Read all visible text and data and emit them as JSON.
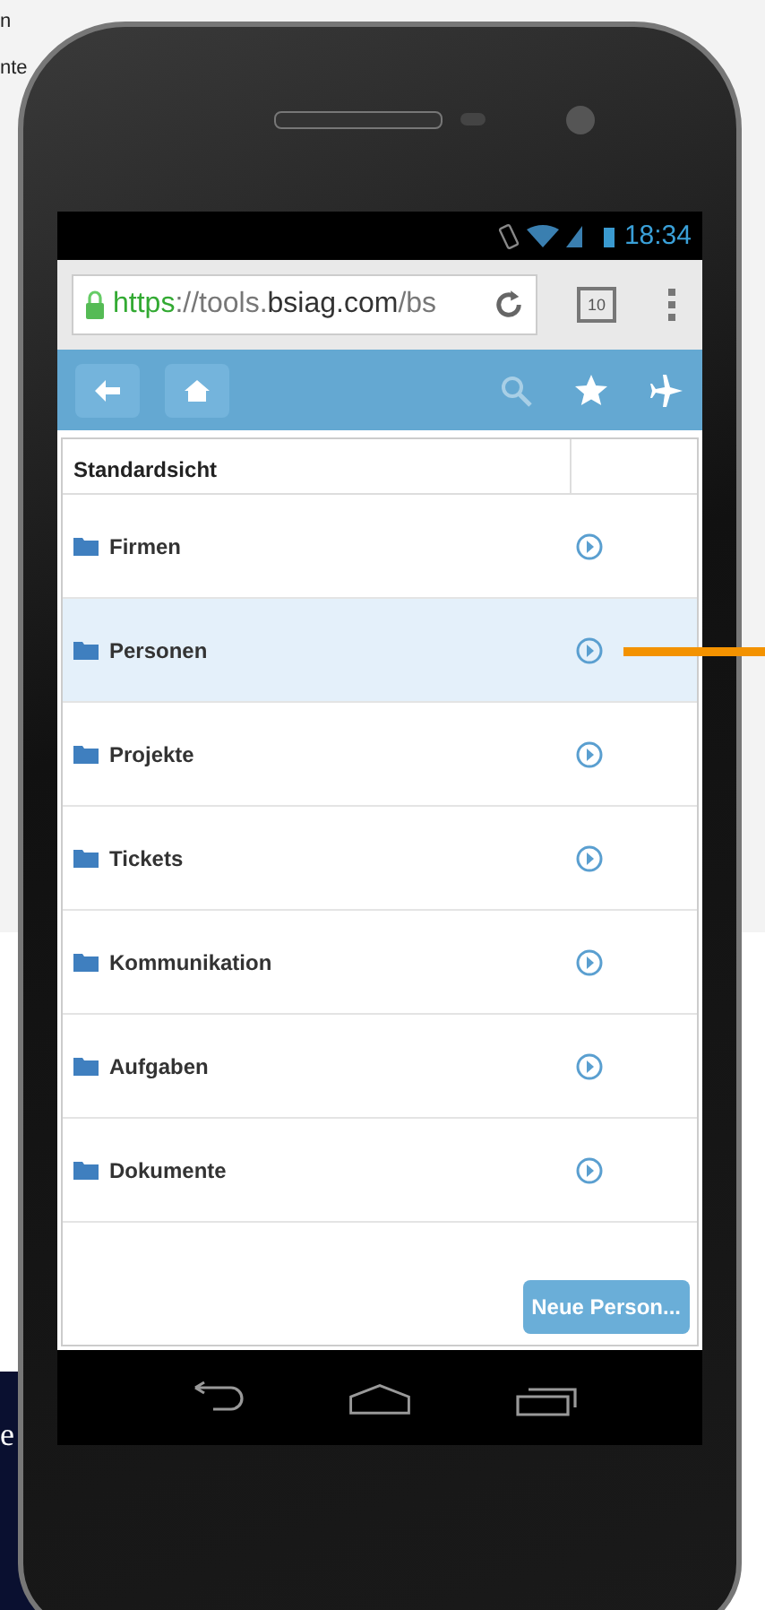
{
  "background": {
    "texts": [
      "n",
      "nte",
      "e"
    ]
  },
  "status_bar": {
    "time": "18:34"
  },
  "browser": {
    "url_scheme": "https",
    "url_host_pre": "://tools.",
    "url_host": "bsiag.com",
    "url_path": "/bs",
    "tab_count": "10"
  },
  "list": {
    "title": "Standardsicht",
    "items": [
      {
        "label": "Firmen",
        "selected": false
      },
      {
        "label": "Personen",
        "selected": true
      },
      {
        "label": "Projekte",
        "selected": false
      },
      {
        "label": "Tickets",
        "selected": false
      },
      {
        "label": "Kommunikation",
        "selected": false
      },
      {
        "label": "Aufgaben",
        "selected": false
      },
      {
        "label": "Dokumente",
        "selected": false
      }
    ]
  },
  "buttons": [
    "Neue Person..."
  ]
}
